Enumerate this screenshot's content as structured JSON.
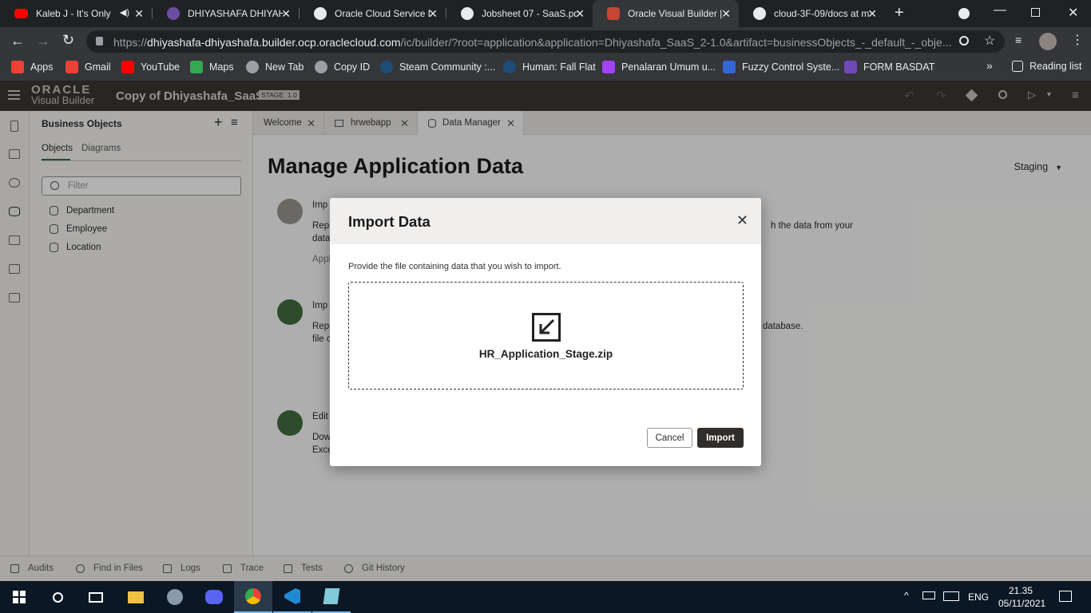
{
  "browser": {
    "tabs": [
      {
        "title": "Kaleb J - It's Only",
        "icon": "youtube-icon"
      },
      {
        "title": "DHIYASHAFA DHIYAH",
        "icon": "purple-logo-icon"
      },
      {
        "title": "Oracle Cloud Service D",
        "icon": "globe-icon"
      },
      {
        "title": "Jobsheet 07 - SaaS.pdf",
        "icon": "globe-icon"
      },
      {
        "title": "Oracle Visual Builder |",
        "icon": "oracle-icon"
      },
      {
        "title": "cloud-3F-09/docs at m",
        "icon": "github-icon"
      }
    ],
    "url_prefix": "https://",
    "url_host": "dhiyashafa-dhiyashafa.builder.ocp.oraclecloud.com",
    "url_path": "/ic/builder/?root=application&application=Dhiyashafa_SaaS_2-1.0&artifact=businessObjects_-_default_-_obje...",
    "bookmarks": [
      {
        "label": "Apps",
        "color": "#ea4335"
      },
      {
        "label": "Gmail",
        "color": "#ea4335"
      },
      {
        "label": "YouTube",
        "color": "#ff0000"
      },
      {
        "label": "Maps",
        "color": "#34a853"
      },
      {
        "label": "New Tab",
        "color": "#9aa0a6"
      },
      {
        "label": "Copy ID",
        "color": "#9aa0a6"
      },
      {
        "label": "Steam Community :...",
        "color": "#1b4e7a"
      },
      {
        "label": "Human: Fall Flat",
        "color": "#1b4e7a"
      },
      {
        "label": "Penalaran Umum u...",
        "color": "#a142f4"
      },
      {
        "label": "Fuzzy Control Syste...",
        "color": "#3367d6"
      },
      {
        "label": "FORM BASDAT",
        "color": "#7248b9"
      }
    ],
    "more_bookmarks": "»",
    "reading_list": "Reading list"
  },
  "vb": {
    "logo_line1": "ORACLE",
    "logo_line2": "Visual Builder",
    "app_title": "Copy of Dhiyashafa_SaaS",
    "stage_badge": "STAGE",
    "version_badge": "1.0"
  },
  "business_objects": {
    "title": "Business Objects",
    "tabs": [
      "Objects",
      "Diagrams"
    ],
    "filter_placeholder": "Filter",
    "items": [
      "Department",
      "Employee",
      "Location"
    ]
  },
  "editor_tabs": [
    "Welcome",
    "hrwebapp",
    "Data Manager"
  ],
  "main": {
    "title": "Manage Application Data",
    "environment": "Staging",
    "sections": [
      {
        "line1": "Imp",
        "line2": "Repl",
        "line3": "data",
        "line4": "Appl",
        "right": "h the data from your"
      },
      {
        "line1": "Imp",
        "line2": "Repl",
        "line3": "file c",
        "right": "ging database."
      },
      {
        "line1": "Edit",
        "line2": "Dow",
        "line3": "Exce"
      }
    ]
  },
  "status_bar": [
    "Audits",
    "Find in Files",
    "Logs",
    "Trace",
    "Tests",
    "Git History"
  ],
  "dialog": {
    "title": "Import Data",
    "description": "Provide the file containing data that you wish to import.",
    "file_name": "HR_Application_Stage.zip",
    "cancel_label": "Cancel",
    "import_label": "Import"
  },
  "taskbar": {
    "language": "ENG",
    "time": "21.35",
    "date": "05/11/2021"
  }
}
